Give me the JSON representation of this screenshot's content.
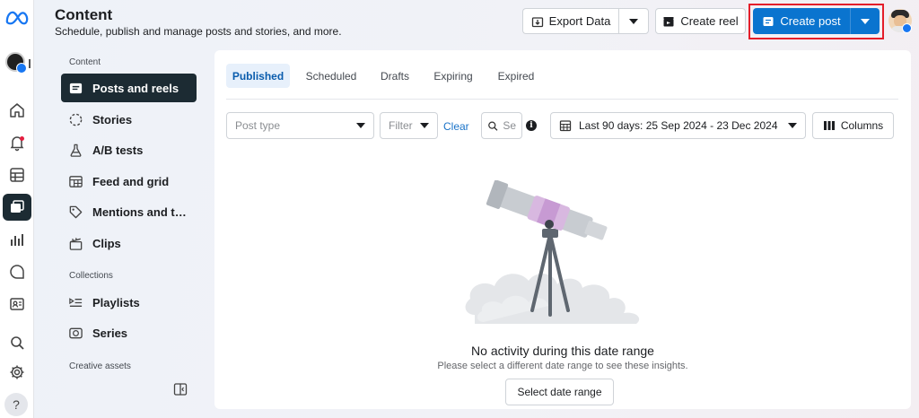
{
  "header": {
    "title": "Content",
    "subtitle": "Schedule, publish and manage posts and stories, and more.",
    "export_label": "Export Data",
    "create_reel_label": "Create reel",
    "create_post_label": "Create post"
  },
  "rail": {
    "icons": [
      "meta-logo-icon",
      "home-icon",
      "bell-icon",
      "table-icon",
      "content-icon",
      "insights-icon",
      "chat-icon",
      "contact-card-icon",
      "search-icon",
      "settings-icon"
    ],
    "help_label": "?"
  },
  "sidebar": {
    "sections": {
      "content": "Content",
      "collections": "Collections",
      "creative_assets": "Creative assets"
    },
    "items": [
      {
        "label": "Posts and reels",
        "icon": "posts-icon"
      },
      {
        "label": "Stories",
        "icon": "stories-icon"
      },
      {
        "label": "A/B tests",
        "icon": "flask-icon"
      },
      {
        "label": "Feed and grid",
        "icon": "grid-icon"
      },
      {
        "label": "Mentions and t…",
        "icon": "tag-icon"
      },
      {
        "label": "Clips",
        "icon": "clapper-icon"
      },
      {
        "label": "Playlists",
        "icon": "playlist-icon"
      },
      {
        "label": "Series",
        "icon": "series-icon"
      }
    ]
  },
  "tabs": [
    {
      "label": "Published",
      "active": true
    },
    {
      "label": "Scheduled"
    },
    {
      "label": "Drafts"
    },
    {
      "label": "Expiring"
    },
    {
      "label": "Expired"
    }
  ],
  "filters": {
    "post_type_placeholder": "Post type",
    "filter_placeholder": "Filter",
    "clear_label": "Clear",
    "search_placeholder": "Se",
    "info_label": "i",
    "date_range": "Last 90 days: 25 Sep 2024 - 23 Dec 2024",
    "columns_label": "Columns"
  },
  "empty_state": {
    "title": "No activity during this date range",
    "subtitle": "Please select a different date range to see these insights.",
    "button_label": "Select date range"
  },
  "colors": {
    "primary": "#0a74cf",
    "active_nav": "#1c2b33",
    "highlight_outline": "#e41e2a",
    "tab_active_bg": "#e7f0fb",
    "link": "#1a73c8"
  }
}
